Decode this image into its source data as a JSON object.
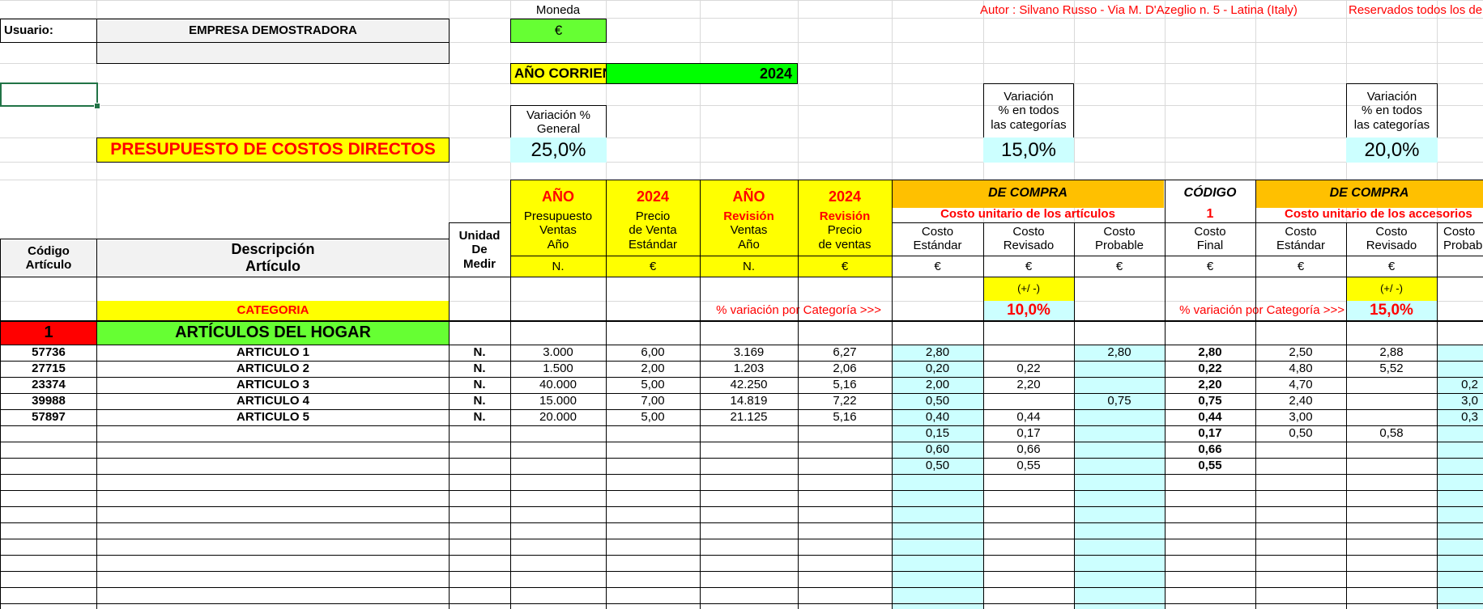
{
  "user_label": "Usuario:",
  "company": "EMPRESA DEMOSTRADORA",
  "currency_label": "Moneda",
  "currency": "€",
  "author": "Autor : Silvano Russo - Via M. D'Azeglio n. 5 - Latina (Italy)",
  "rights": "Reservados todos los derechos",
  "year_label": "AÑO CORRIENTE",
  "year": "2024",
  "title": "PRESUPUESTO DE COSTOS DIRECTOS",
  "var_general_label": [
    "Variación %",
    "General"
  ],
  "var_general_value": "25,0%",
  "var_all_label": [
    "Variación",
    "% en todos",
    "las categorías"
  ],
  "var_all_1": "15,0%",
  "var_all_2": "20,0%",
  "headers": {
    "ano": "AÑO",
    "year": "2024",
    "presupuesto": [
      "Presupuesto",
      "Ventas",
      "Año"
    ],
    "precio_venta": [
      "Precio",
      "de Venta",
      "Estándar"
    ],
    "revision": "Revisión",
    "revision_ventas": [
      "Ventas",
      "Año"
    ],
    "revision_precio": [
      "Precio",
      "de ventas"
    ],
    "de_compra": "DE COMPRA",
    "costo_articulos": "Costo unitario de los artículos",
    "costo_accesorios": "Costo unitario de los accesorios",
    "codigo": "CÓDIGO",
    "codigo_num": "1",
    "costo": "Costo",
    "estandar": "Estándar",
    "revisado": "Revisado",
    "probable": "Probable",
    "final": "Final",
    "unidad": [
      "Unidad",
      "De",
      "Medir"
    ],
    "codigo_art": [
      "Código",
      "Artículo"
    ],
    "descripcion": [
      "Descripción",
      "Artículo"
    ],
    "unit_n": "N.",
    "unit_eur": "€",
    "plus_minus": "(+/ -)",
    "categoria": "CATEGORIA",
    "var_cat_label": "% variación por Categoría >>>",
    "var_cat_1": "10,0%",
    "var_cat_2": "15,0%"
  },
  "category_num": "1",
  "category_name": "ARTÍCULOS DEL HOGAR",
  "rows": [
    {
      "code": "57736",
      "desc": "ARTICULO 1",
      "unit": "N.",
      "pres": "3.000",
      "precio": "6,00",
      "rev": "3.169",
      "revp": "6,27",
      "est": "2,80",
      "revis": "",
      "prob": "2,80",
      "final": "2,80",
      "a_est": "2,50",
      "a_rev": "2,88",
      "a_prob": ""
    },
    {
      "code": "27715",
      "desc": "ARTICULO 2",
      "unit": "N.",
      "pres": "1.500",
      "precio": "2,00",
      "rev": "1.203",
      "revp": "2,06",
      "est": "0,20",
      "revis": "0,22",
      "prob": "",
      "final": "0,22",
      "a_est": "4,80",
      "a_rev": "5,52",
      "a_prob": ""
    },
    {
      "code": "23374",
      "desc": "ARTICULO 3",
      "unit": "N.",
      "pres": "40.000",
      "precio": "5,00",
      "rev": "42.250",
      "revp": "5,16",
      "est": "2,00",
      "revis": "2,20",
      "prob": "",
      "final": "2,20",
      "a_est": "4,70",
      "a_rev": "",
      "a_prob": "0,2"
    },
    {
      "code": "39988",
      "desc": "ARTICULO 4",
      "unit": "N.",
      "pres": "15.000",
      "precio": "7,00",
      "rev": "14.819",
      "revp": "7,22",
      "est": "0,50",
      "revis": "",
      "prob": "0,75",
      "final": "0,75",
      "a_est": "2,40",
      "a_rev": "",
      "a_prob": "3,0"
    },
    {
      "code": "57897",
      "desc": "ARTICULO 5",
      "unit": "N.",
      "pres": "20.000",
      "precio": "5,00",
      "rev": "21.125",
      "revp": "5,16",
      "est": "0,40",
      "revis": "0,44",
      "prob": "",
      "final": "0,44",
      "a_est": "3,00",
      "a_rev": "",
      "a_prob": "0,3"
    },
    {
      "code": "",
      "desc": "",
      "unit": "",
      "pres": "",
      "precio": "",
      "rev": "",
      "revp": "",
      "est": "0,15",
      "revis": "0,17",
      "prob": "",
      "final": "0,17",
      "a_est": "0,50",
      "a_rev": "0,58",
      "a_prob": ""
    },
    {
      "code": "",
      "desc": "",
      "unit": "",
      "pres": "",
      "precio": "",
      "rev": "",
      "revp": "",
      "est": "0,60",
      "revis": "0,66",
      "prob": "",
      "final": "0,66",
      "a_est": "",
      "a_rev": "",
      "a_prob": ""
    },
    {
      "code": "",
      "desc": "",
      "unit": "",
      "pres": "",
      "precio": "",
      "rev": "",
      "revp": "",
      "est": "0,50",
      "revis": "0,55",
      "prob": "",
      "final": "0,55",
      "a_est": "",
      "a_rev": "",
      "a_prob": ""
    }
  ],
  "colors": {
    "yellow": "#ffff00",
    "green": "#66ff33",
    "orange": "#ffc000",
    "cyan": "#ccffff",
    "red": "#ff0000",
    "selection": "#217346"
  }
}
